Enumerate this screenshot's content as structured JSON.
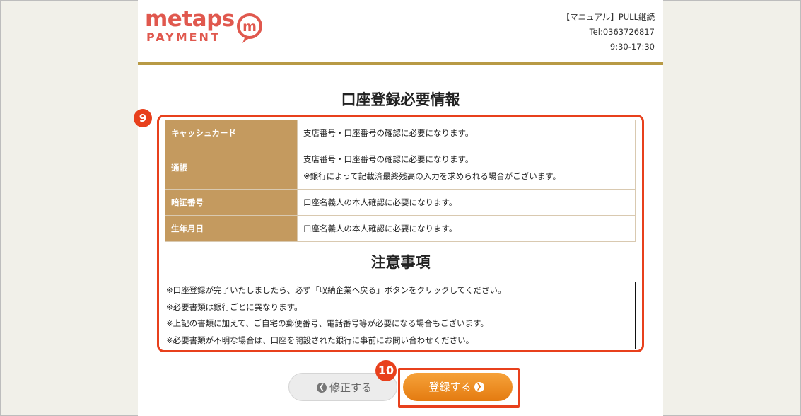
{
  "header": {
    "logo_top": "metaps",
    "logo_bottom": "PAYMENT",
    "logo_mark": "m",
    "contact": {
      "manual": "【マニュアル】PULL継続",
      "tel": "Tel:0363726817",
      "hours": "9:30-17:30"
    }
  },
  "required_section": {
    "title": "口座登録必要情報",
    "rows": [
      {
        "label": "キャッシュカード",
        "lines": [
          "支店番号・口座番号の確認に必要になります。"
        ]
      },
      {
        "label": "通帳",
        "lines": [
          "支店番号・口座番号の確認に必要になります。",
          "※銀行によって記載済最終残高の入力を求められる場合がございます。"
        ]
      },
      {
        "label": "暗証番号",
        "lines": [
          "口座名義人の本人確認に必要になります。"
        ]
      },
      {
        "label": "生年月日",
        "lines": [
          "口座名義人の本人確認に必要になります。"
        ]
      }
    ]
  },
  "notes_section": {
    "title": "注意事項",
    "lines": [
      "※口座登録が完了いたしましたら、必ず「収納企業へ戻る」ボタンをクリックしてください。",
      "※必要書類は銀行ごとに異なります。",
      "※上記の書類に加えて、ご自宅の郵便番号、電話番号等が必要になる場合もございます。",
      "※必要書類が不明な場合は、口座を開設された銀行に事前にお問い合わせください。"
    ]
  },
  "annotations": {
    "badge_9": "9",
    "badge_10": "10",
    "highlight_color": "#e8401c"
  },
  "buttons": {
    "back_label": "修正する",
    "back_icon": "arrow-left-circle-icon",
    "register_label": "登録する",
    "register_icon": "arrow-right-circle-icon"
  },
  "colors": {
    "brand": "#e0584e",
    "accent_rule": "#b89a45",
    "table_header": "#c49a5f",
    "register_button": "#ef8c22"
  }
}
